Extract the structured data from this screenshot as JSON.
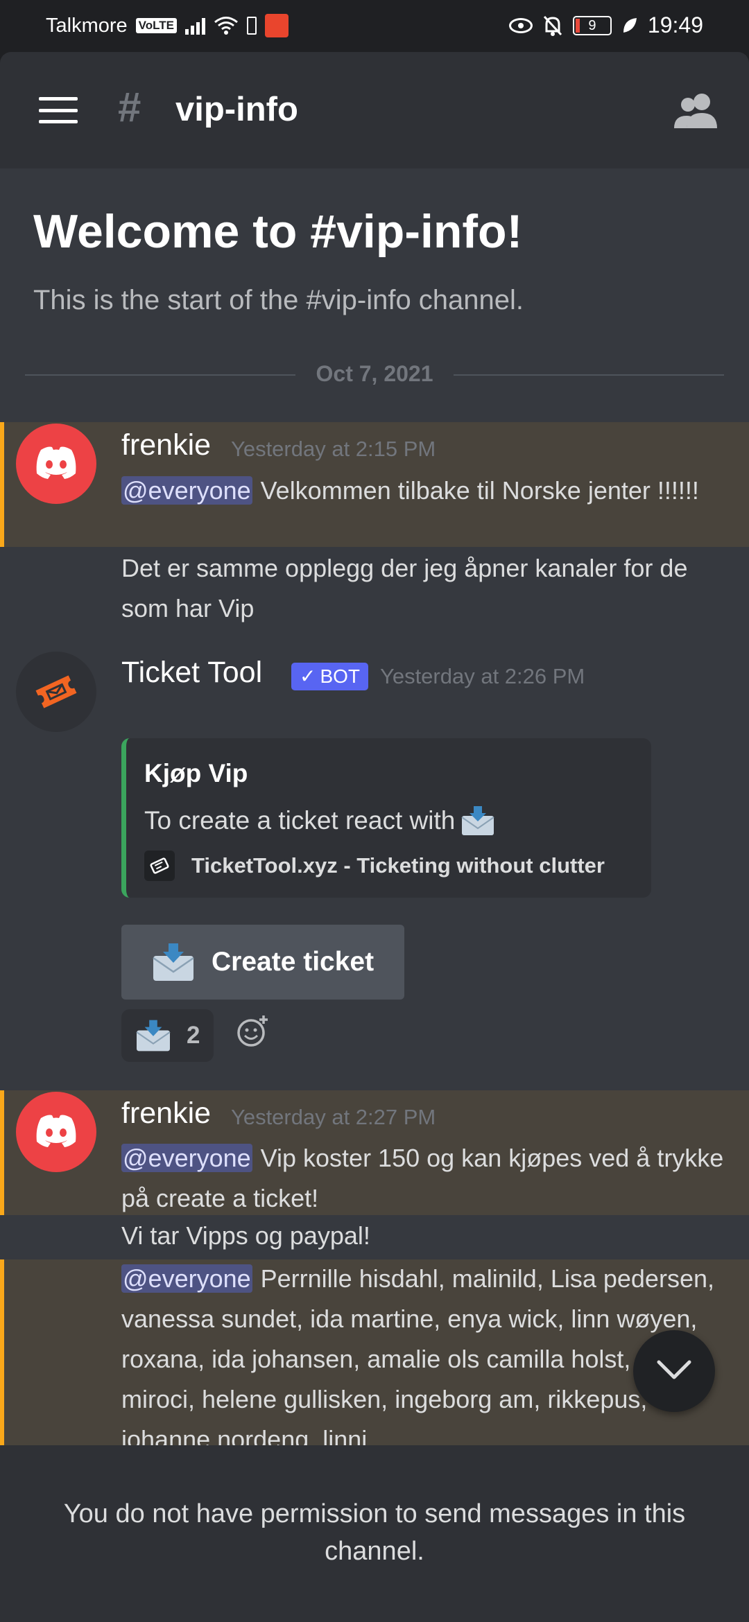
{
  "status_bar": {
    "carrier": "Talkmore",
    "volte": "VoLTE",
    "battery_level": "9",
    "time": "19:49"
  },
  "header": {
    "channel_name": "vip-info",
    "hash_symbol": "#"
  },
  "welcome": {
    "title": "Welcome to #vip-info!",
    "subtitle": "This is the start of the #vip-info channel."
  },
  "date_divider": "Oct 7, 2021",
  "messages": [
    {
      "author": "frenkie",
      "timestamp": "Yesterday at 2:15 PM",
      "mention": "@everyone",
      "text": "Velkommen tilbake til Norske jenter !!!!!!",
      "followup": "Det er samme opplegg der jeg åpner kanaler for de som har Vip"
    },
    {
      "author": "Ticket Tool",
      "bot_tag": "BOT",
      "timestamp": "Yesterday at 2:26 PM",
      "embed": {
        "title": "Kjøp Vip",
        "description": "To create a ticket react with",
        "footer": "TicketTool.xyz - Ticketing without clutter"
      },
      "button_label": "Create ticket",
      "reaction_count": "2"
    },
    {
      "author": "frenkie",
      "timestamp": "Yesterday at 2:27 PM",
      "mention": "@everyone",
      "text": "Vip koster 150 og kan kjøpes ved å trykke på create a ticket!",
      "followup": "Vi tar Vipps og paypal!",
      "mention2": "@everyone",
      "text2": "Perrnille hisdahl, malinild, Lisa pedersen, vanessa sundet, ida martine, enya wick, linn wøyen, roxana, ida johansen, amalie ols camilla holst, genta miroci, helene gullisken, ingeborg am, rikkepus, johanne nordeng, linni"
    }
  ],
  "no_permission": "You do not have permission to send messages in this channel.",
  "colors": {
    "mention_highlight": "#49443c",
    "mention_bar": "#faa81a",
    "bot_tag": "#5865f2",
    "embed_bar": "#3ba55d",
    "discord_red": "#ed4245"
  }
}
